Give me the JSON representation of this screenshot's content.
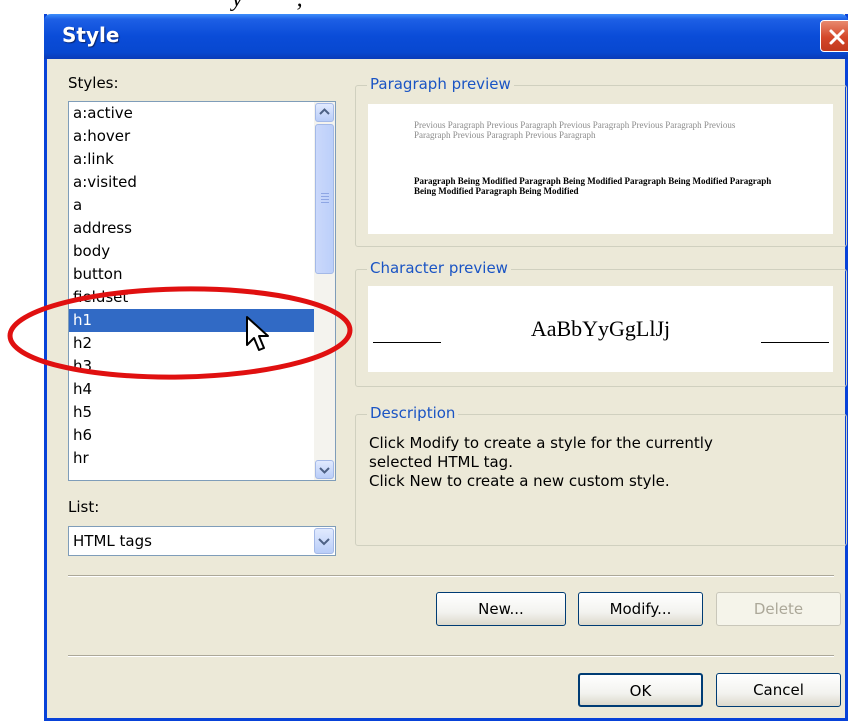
{
  "window": {
    "title": "Style"
  },
  "styles_label": "Styles:",
  "styles_list": [
    "a:active",
    "a:hover",
    "a:link",
    "a:visited",
    "a",
    "address",
    "body",
    "button",
    "fieldset",
    "h1",
    "h2",
    "h3",
    "h4",
    "h5",
    "h6",
    "hr"
  ],
  "selected_style": "h1",
  "list_label": "List:",
  "list_value": "HTML tags",
  "paragraph_preview": {
    "label": "Paragraph preview",
    "previous": "Previous Paragraph Previous Paragraph Previous Paragraph Previous Paragraph Previous Paragraph Previous Paragraph Previous Paragraph",
    "modified": "Paragraph Being Modified Paragraph Being Modified Paragraph Being Modified Paragraph Being Modified Paragraph Being Modified"
  },
  "character_preview": {
    "label": "Character preview",
    "sample": "AaBbYyGgLlJj"
  },
  "description": {
    "label": "Description",
    "line1": "Click Modify to create a style for the currently",
    "line2": "selected HTML tag.",
    "line3": "Click New to create a new custom style."
  },
  "buttons": {
    "new": "New...",
    "modify": "Modify...",
    "delete": "Delete",
    "ok": "OK",
    "cancel": "Cancel"
  },
  "colors": {
    "selection": "#316ac5",
    "annotation": "#e01010",
    "legend_text": "#1a54c4"
  },
  "icons": [
    "close-icon",
    "scroll-up-icon",
    "scroll-down-icon",
    "dropdown-arrow-icon",
    "mouse-cursor-icon"
  ]
}
